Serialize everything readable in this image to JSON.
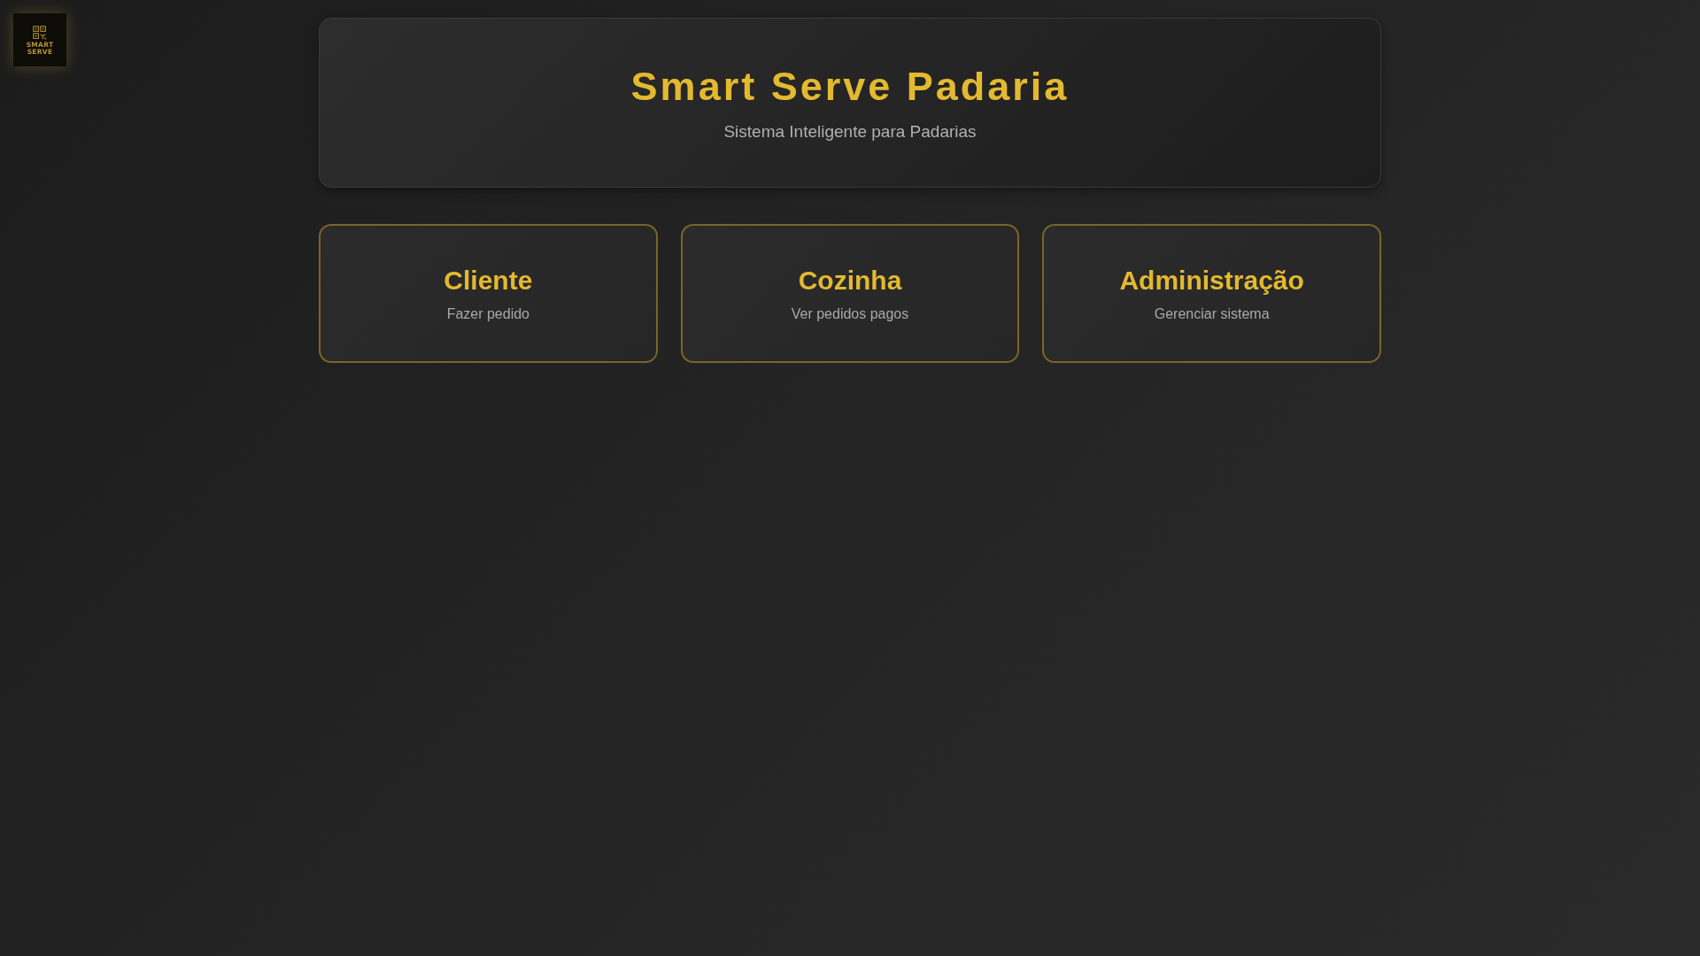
{
  "logo": {
    "lines": [
      "SMART",
      "SERVE"
    ]
  },
  "header": {
    "title": "Smart Serve Padaria",
    "subtitle": "Sistema Inteligente para Padarias"
  },
  "cards": [
    {
      "title": "Cliente",
      "subtitle": "Fazer pedido"
    },
    {
      "title": "Cozinha",
      "subtitle": "Ver pedidos pagos"
    },
    {
      "title": "Administração",
      "subtitle": "Gerenciar sistema"
    }
  ]
}
